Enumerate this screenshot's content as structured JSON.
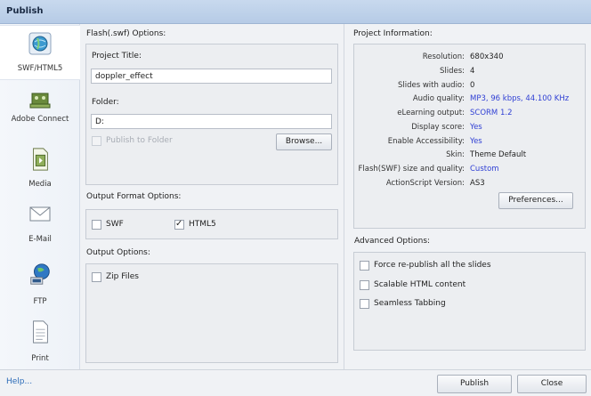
{
  "window": {
    "title": "Publish"
  },
  "sidebar": {
    "items": [
      {
        "label": "SWF/HTML5",
        "icon": "globe-swf-icon",
        "selected": true
      },
      {
        "label": "Adobe Connect",
        "icon": "adobe-connect-icon",
        "selected": false
      },
      {
        "label": "Media",
        "icon": "media-file-icon",
        "selected": false
      },
      {
        "label": "E-Mail",
        "icon": "envelope-icon",
        "selected": false
      },
      {
        "label": "FTP",
        "icon": "globe-ftp-icon",
        "selected": false
      },
      {
        "label": "Print",
        "icon": "document-icon",
        "selected": false
      }
    ]
  },
  "flash_options": {
    "heading": "Flash(.swf) Options:",
    "project_title_label": "Project Title:",
    "project_title_value": "doppler_effect",
    "folder_label": "Folder:",
    "folder_value": "D:",
    "publish_to_folder_label": "Publish to Folder",
    "publish_to_folder_checked": false,
    "browse_label": "Browse..."
  },
  "output_format": {
    "heading": "Output Format Options:",
    "swf_label": "SWF",
    "swf_checked": false,
    "html5_label": "HTML5",
    "html5_checked": true
  },
  "output_options": {
    "heading": "Output Options:",
    "zip_label": "Zip Files",
    "zip_checked": false
  },
  "project_info": {
    "heading": "Project Information:",
    "rows": [
      {
        "key": "Resolution:",
        "value": "680x340",
        "highlight": false
      },
      {
        "key": "Slides:",
        "value": "4",
        "highlight": false
      },
      {
        "key": "Slides with audio:",
        "value": "0",
        "highlight": false
      },
      {
        "key": "Audio quality:",
        "value": "MP3, 96 kbps, 44.100 KHz",
        "highlight": true
      },
      {
        "key": "eLearning output:",
        "value": "SCORM 1.2",
        "highlight": true
      },
      {
        "key": "Display score:",
        "value": "Yes",
        "highlight": true
      },
      {
        "key": "Enable Accessibility:",
        "value": "Yes",
        "highlight": true
      },
      {
        "key": "Skin:",
        "value": "Theme Default",
        "highlight": false
      },
      {
        "key": "Flash(SWF) size and quality:",
        "value": "Custom",
        "highlight": true
      },
      {
        "key": "ActionScript Version:",
        "value": "AS3",
        "highlight": false
      }
    ],
    "preferences_label": "Preferences...",
    "link_color": "#2f3fd4"
  },
  "advanced": {
    "heading": "Advanced Options:",
    "options": [
      {
        "label": "Force re-publish all the slides",
        "checked": false
      },
      {
        "label": "Scalable HTML content",
        "checked": false
      },
      {
        "label": "Seamless Tabbing",
        "checked": false
      }
    ]
  },
  "footer": {
    "help_label": "Help...",
    "publish_label": "Publish",
    "close_label": "Close"
  }
}
